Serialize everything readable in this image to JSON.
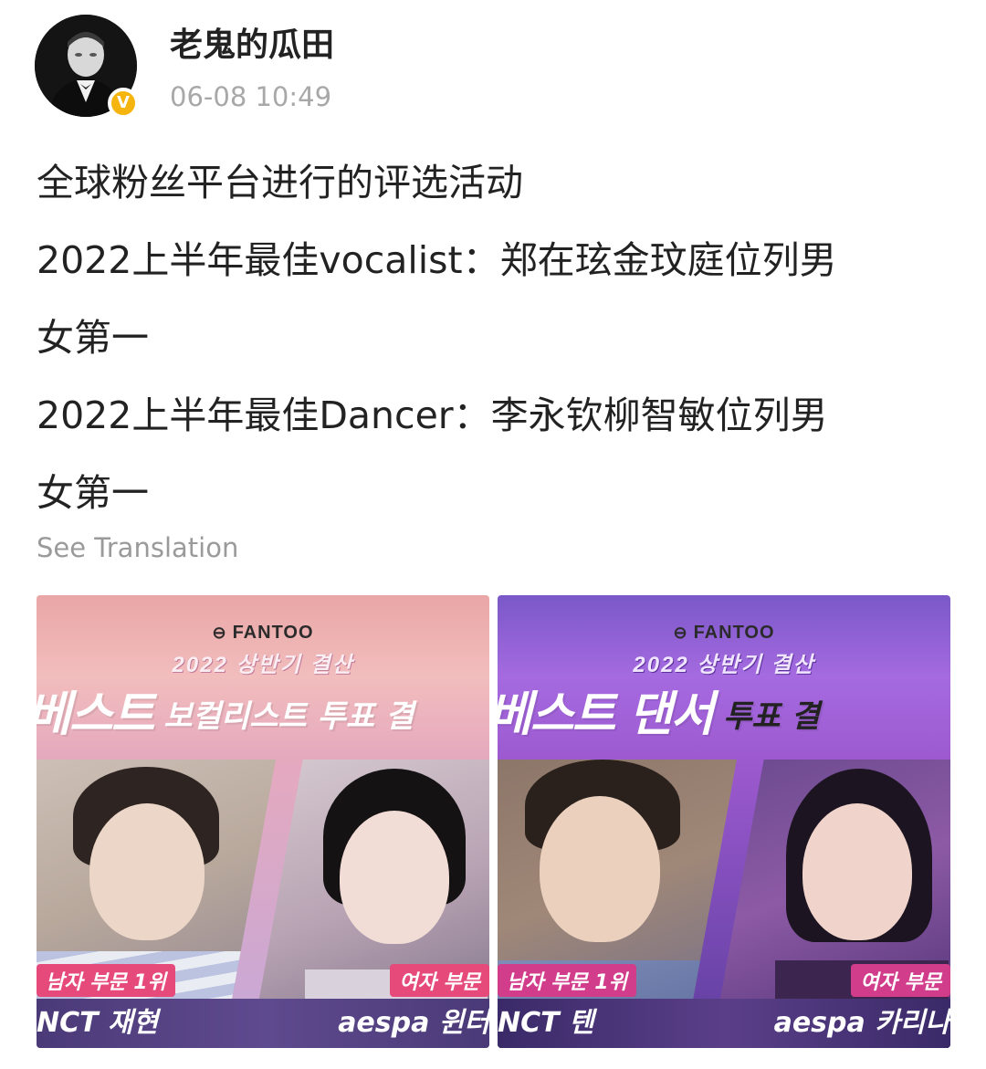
{
  "post": {
    "username": "老鬼的瓜田",
    "timestamp": "06-08 10:49",
    "verified_badge": "V",
    "lines": [
      "全球粉丝平台进行的评选活动",
      "2022上半年最佳vocalist：郑在玹金玟庭位列男",
      "女第一",
      "2022上半年最佳Dancer：李永钦柳智敏位列男",
      "女第一"
    ],
    "see_translation": "See Translation"
  },
  "images": [
    {
      "brand": "FANTOO",
      "subtitle": "2022 상반기 결산",
      "banner_main": "베스트",
      "banner_small": " 보컬리스트 투표 결",
      "rank_left": "남자 부문 1위",
      "rank_right": "여자 부문",
      "name_left": "NCT 재현",
      "name_right": "aespa 윈터"
    },
    {
      "brand": "FANTOO",
      "subtitle": "2022 상반기 결산",
      "banner_main": "베스트 댄서",
      "banner_small": " 투표 결",
      "rank_left": "남자 부문 1위",
      "rank_right": "여자 부문",
      "name_left": "NCT 텐",
      "name_right": "aespa 카리나"
    }
  ],
  "icons": {
    "avatar": "avatar-portrait",
    "verified": "verified-badge-icon",
    "brand_logo": "fantoo-logo-icon"
  },
  "colors": {
    "verified": "#f6b40e",
    "text": "#222222",
    "muted": "#a8a8a8"
  }
}
